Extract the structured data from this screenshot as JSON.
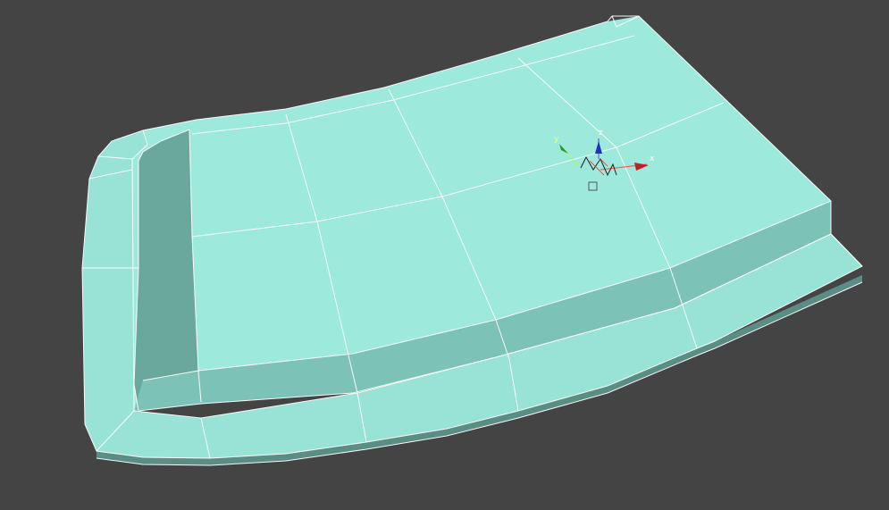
{
  "viewport": {
    "background_color": "#444444"
  },
  "model": {
    "top_color": "#9de9dc",
    "side_color": "#7dc2b6",
    "wire_color": "#ffffff"
  },
  "gizmo": {
    "axis_x_label": "x",
    "axis_y_label": "y",
    "axis_z_label": "z",
    "x_color": "#c0202a",
    "y_color": "#1f9a2e",
    "z_color": "#1f2fbf"
  }
}
